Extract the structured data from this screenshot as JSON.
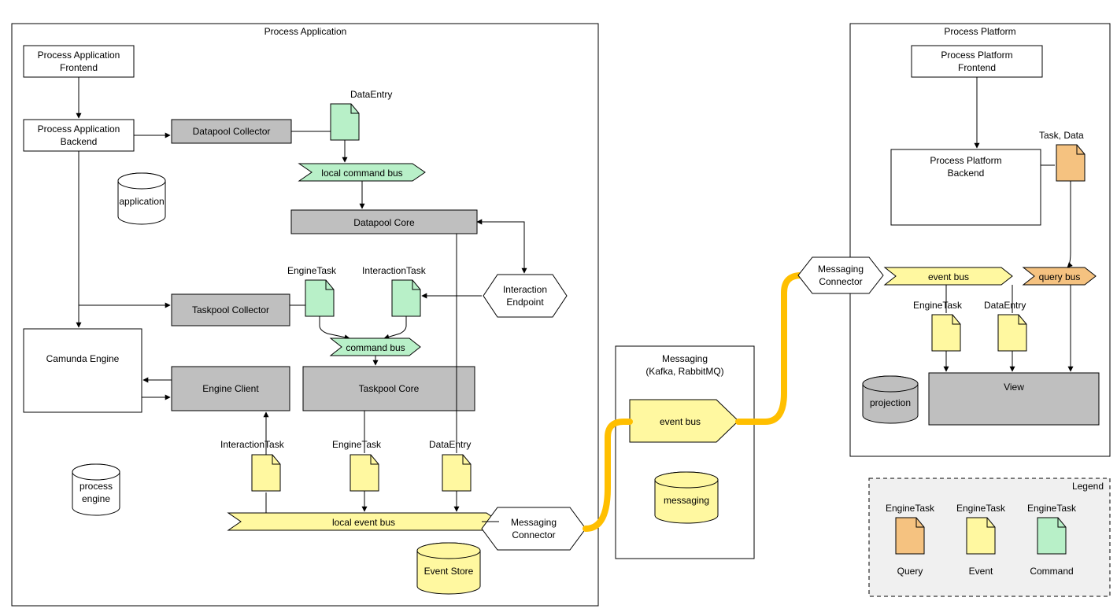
{
  "containers": {
    "process_application": "Process Application",
    "process_platform": "Process Platform",
    "messaging": "Messaging\n(Kafka, RabbitMQ)",
    "legend": "Legend"
  },
  "boxes": {
    "pa_frontend": "Process Application\nFrontend",
    "pa_backend": "Process Application\nBackend",
    "datapool_collector": "Datapool Collector",
    "datapool_core": "Datapool Core",
    "taskpool_collector": "Taskpool Collector",
    "taskpool_core": "Taskpool Core",
    "engine_client": "Engine Client",
    "camunda_engine": "Camunda Engine",
    "interaction_endpoint": "Interaction\nEndpoint",
    "messaging_connector": "Messaging\nConnector",
    "pp_frontend": "Process Platform\nFrontend",
    "pp_backend": "Process Platform\nBackend",
    "pp_messaging_connector": "Messaging\nConnector",
    "view": "View"
  },
  "cylinders": {
    "application": "application",
    "process_engine": "process\nengine",
    "event_store": "Event Store",
    "messaging_db": "messaging",
    "projection": "projection"
  },
  "notes": {
    "data_entry_green": "DataEntry",
    "engine_task_green": "EngineTask",
    "interaction_task_green": "InteractionTask",
    "interaction_task_yellow": "InteractionTask",
    "engine_task_yellow": "EngineTask",
    "data_entry_yellow": "DataEntry",
    "task_data_orange": "Task, Data",
    "pp_engine_task_yellow": "EngineTask",
    "pp_data_entry_yellow": "DataEntry"
  },
  "buses": {
    "local_command_bus": "local command bus",
    "command_bus": "command bus",
    "local_event_bus": "local event bus",
    "event_bus_center": "event bus",
    "pp_event_bus": "event bus",
    "pp_query_bus": "query bus"
  },
  "legend": {
    "query": {
      "top": "EngineTask",
      "bottom": "Query"
    },
    "event": {
      "top": "EngineTask",
      "bottom": "Event"
    },
    "command": {
      "top": "EngineTask",
      "bottom": "Command"
    }
  },
  "colors": {
    "gray": "#bfbfbf",
    "green": "#b8f0c8",
    "yellow": "#fff8a0",
    "orange": "#f5c280",
    "thick": "#ffbf00",
    "legend_bg": "#f0f0f0"
  }
}
